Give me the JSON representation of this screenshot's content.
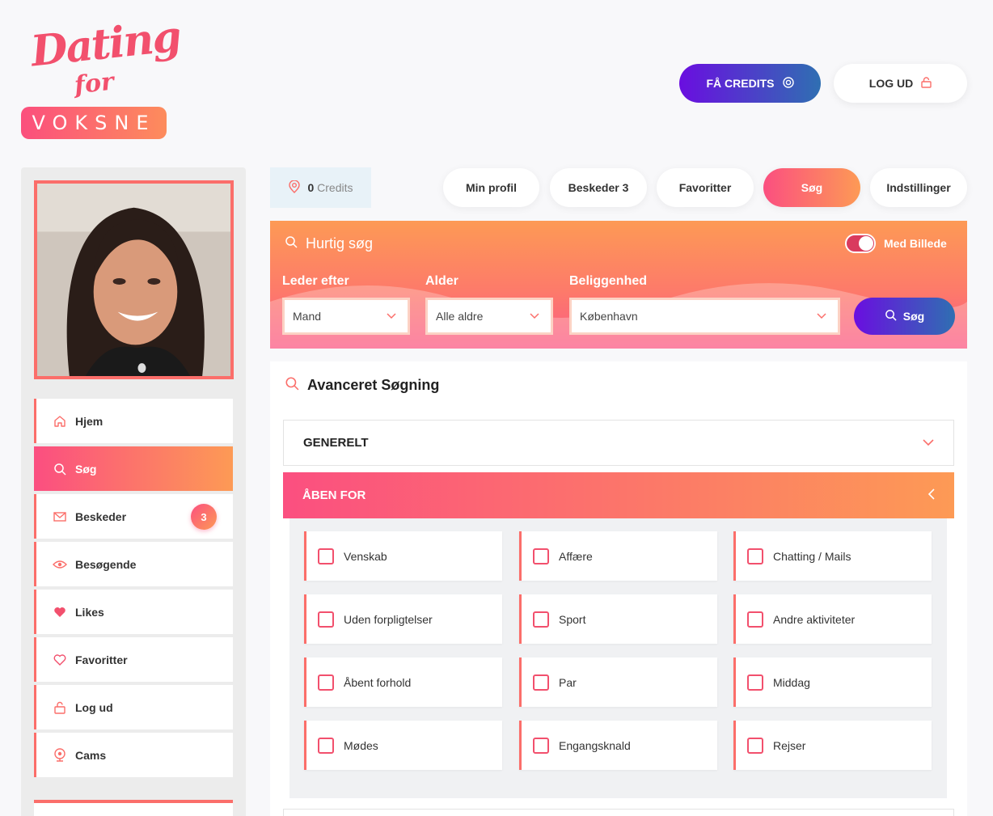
{
  "logo": {
    "line1": "Dating",
    "line2": "for",
    "line3": "VOKSNE"
  },
  "header": {
    "credits_label": "FÅ CREDITS",
    "logout_label": "LOG UD"
  },
  "sidebar": {
    "menu": [
      {
        "label": "Hjem",
        "icon": "home-icon"
      },
      {
        "label": "Søg",
        "icon": "search-icon",
        "active": true
      },
      {
        "label": "Beskeder",
        "icon": "mail-icon",
        "badge": "3"
      },
      {
        "label": "Besøgende",
        "icon": "eye-icon"
      },
      {
        "label": "Likes",
        "icon": "heart-filled-icon"
      },
      {
        "label": "Favoritter",
        "icon": "heart-outline-icon"
      },
      {
        "label": "Log ud",
        "icon": "lock-icon"
      },
      {
        "label": "Cams",
        "icon": "webcam-icon"
      }
    ]
  },
  "topnav": {
    "credits_count": "0",
    "credits_label": "Credits",
    "tabs": [
      "Min profil",
      "Beskeder 3",
      "Favoritter",
      "Søg",
      "Indstillinger"
    ],
    "active_tab": "Søg"
  },
  "quick_search": {
    "title": "Hurtig søg",
    "toggle_label": "Med Billede",
    "toggle_on": true,
    "fields": [
      {
        "label": "Leder efter",
        "value": "Mand"
      },
      {
        "label": "Alder",
        "value": "Alle aldre"
      },
      {
        "label": "Beliggenhed",
        "value": "København"
      }
    ],
    "search_button": "Søg"
  },
  "advanced": {
    "title": "Avanceret Søgning",
    "sections": [
      {
        "label": "GENERELT",
        "expanded": false
      },
      {
        "label": "ÅBEN FOR",
        "expanded": true
      }
    ],
    "options": [
      "Venskab",
      "Affære",
      "Chatting / Mails",
      "Uden forpligtelser",
      "Sport",
      "Andre aktiviteter",
      "Åbent forhold",
      "Par",
      "Middag",
      "Mødes",
      "Engangsknald",
      "Rejser"
    ]
  },
  "colors": {
    "accent_pink": "#fb4f80",
    "accent_orange": "#fd9a55",
    "accent_purple": "#6a0ee0",
    "accent_blue": "#2f6fb2"
  }
}
